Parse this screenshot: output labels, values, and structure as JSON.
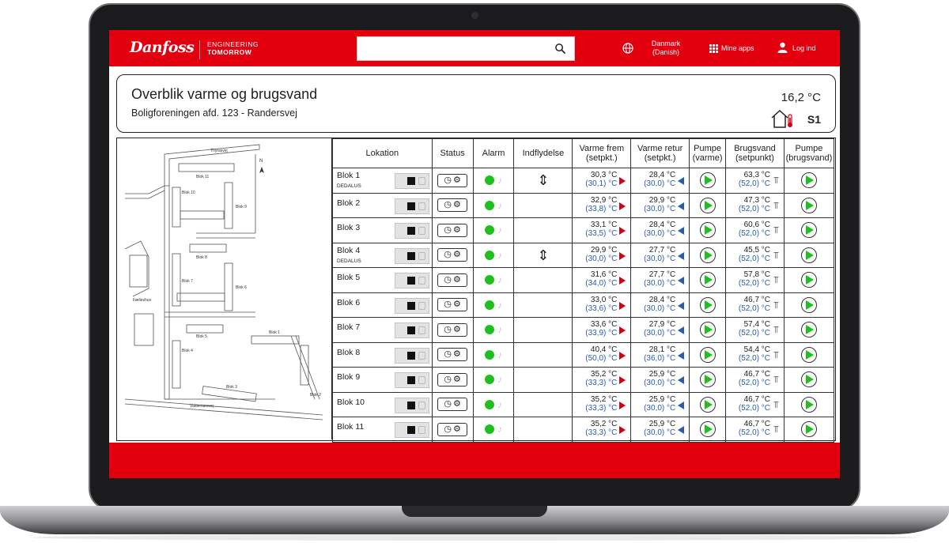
{
  "brand": {
    "logo": "Danfoss",
    "tagline_1": "ENGINEERING",
    "tagline_2": "TOMORROW"
  },
  "nav": {
    "country": "Danmark",
    "language": "(Danish)",
    "apps": "Mine apps",
    "login": "Log ind"
  },
  "header": {
    "title": "Overblik varme og brugsvand",
    "subtitle": "Boligforeningen afd. 123 - Randersvej",
    "outdoor_temp": "16,2 °C",
    "station": "S1"
  },
  "table": {
    "headers": {
      "lokation": "Lokation",
      "status": "Status",
      "alarm": "Alarm",
      "indflydelse": "Indflydelse",
      "varme_frem_1": "Varme frem",
      "varme_frem_2": "(setpkt.)",
      "varme_retur_1": "Varme retur",
      "varme_retur_2": "(setpkt.)",
      "pumpe_varme_1": "Pumpe",
      "pumpe_varme_2": "(varme)",
      "brugsvand_1": "Brugsvand",
      "brugsvand_2": "(setpunkt)",
      "pumpe_brugs_1": "Pumpe",
      "pumpe_brugs_2": "(brugsvand)"
    },
    "rows": [
      {
        "name": "Blok 1",
        "sub": "DEDALUS",
        "influence": "⇕",
        "vf": "30,3 °C",
        "vf_sp": "(30,1) °C",
        "vr": "28,4 °C",
        "vr_sp": "(30,0) °C",
        "bv": "63,3 °C",
        "bv_sp": "(52,0) °C"
      },
      {
        "name": "Blok 2",
        "sub": "",
        "influence": "",
        "vf": "32,9 °C",
        "vf_sp": "(33,8) °C",
        "vr": "29,9 °C",
        "vr_sp": "(30,0) °C",
        "bv": "47,3 °C",
        "bv_sp": "(52,0) °C"
      },
      {
        "name": "Blok 3",
        "sub": "",
        "influence": "",
        "vf": "33,1 °C",
        "vf_sp": "(33,5) °C",
        "vr": "28,4 °C",
        "vr_sp": "(30,0) °C",
        "bv": "60,6 °C",
        "bv_sp": "(52,0) °C"
      },
      {
        "name": "Blok 4",
        "sub": "DEDALUS",
        "influence": "⇕",
        "vf": "29,9 °C",
        "vf_sp": "(30,0) °C",
        "vr": "27,7 °C",
        "vr_sp": "(30,0) °C",
        "bv": "45,5 °C",
        "bv_sp": "(52,0) °C"
      },
      {
        "name": "Blok 5",
        "sub": "",
        "influence": "",
        "vf": "31,6 °C",
        "vf_sp": "(34,0) °C",
        "vr": "27,7 °C",
        "vr_sp": "(30,0) °C",
        "bv": "57,8 °C",
        "bv_sp": "(52,0) °C"
      },
      {
        "name": "Blok 6",
        "sub": "",
        "influence": "",
        "vf": "33,0 °C",
        "vf_sp": "(33,6) °C",
        "vr": "28,4 °C",
        "vr_sp": "(30,0) °C",
        "bv": "46,7 °C",
        "bv_sp": "(52,0) °C"
      },
      {
        "name": "Blok 7",
        "sub": "",
        "influence": "",
        "vf": "33,6 °C",
        "vf_sp": "(33,9) °C",
        "vr": "27,9 °C",
        "vr_sp": "(30,0) °C",
        "bv": "57,4 °C",
        "bv_sp": "(52,0) °C"
      },
      {
        "name": "Blok 8",
        "sub": "",
        "influence": "",
        "vf": "40,4 °C",
        "vf_sp": "(50,0) °C",
        "vr": "28,1 °C",
        "vr_sp": "(36,0) °C",
        "bv": "54,4 °C",
        "bv_sp": "(52,0) °C"
      },
      {
        "name": "Blok 9",
        "sub": "",
        "influence": "",
        "vf": "35,2 °C",
        "vf_sp": "(33,3) °C",
        "vr": "25,9 °C",
        "vr_sp": "(30,0) °C",
        "bv": "46,7 °C",
        "bv_sp": "(52,0) °C"
      },
      {
        "name": "Blok 10",
        "sub": "",
        "influence": "",
        "vf": "35,2 °C",
        "vf_sp": "(33,3) °C",
        "vr": "25,9 °C",
        "vr_sp": "(30,0) °C",
        "bv": "46,7 °C",
        "bv_sp": "(52,0) °C"
      },
      {
        "name": "Blok 11",
        "sub": "",
        "influence": "",
        "vf": "35,2 °C",
        "vf_sp": "(33,3) °C",
        "vr": "25,9 °C",
        "vr_sp": "(30,0) °C",
        "bv": "46,7 °C",
        "bv_sp": "(52,0) °C"
      }
    ]
  },
  "map_labels": {
    "street_1": "Thyrasvej",
    "street_2": "Valdemarsvej",
    "blok_1": "Blok 1",
    "blok_2": "Blok 2",
    "blok_3": "Blok 3",
    "blok_4": "Blok 4",
    "blok_5": "Blok 5",
    "blok_6": "Blok 6",
    "blok_7": "Blok 7",
    "blok_8": "Blok 8",
    "blok_9": "Blok 9",
    "blok_10": "Blok 10",
    "blok_11": "Blok 11",
    "north": "N",
    "faelleshus": "Fælleshus"
  },
  "colors": {
    "brand_red": "#e2000f",
    "ok_green": "#1ec01e",
    "setpoint_blue": "#2a5ca8",
    "flow_red": "#d10016"
  },
  "icons": {
    "search": "search-icon",
    "globe": "globe-icon",
    "apps": "grid-icon",
    "user": "user-icon",
    "house": "house-thermometer-icon",
    "clock": "clock-icon",
    "gear": "gear-icon",
    "bell": "bell-icon",
    "tap": "tap-icon",
    "pump": "pump-icon"
  }
}
